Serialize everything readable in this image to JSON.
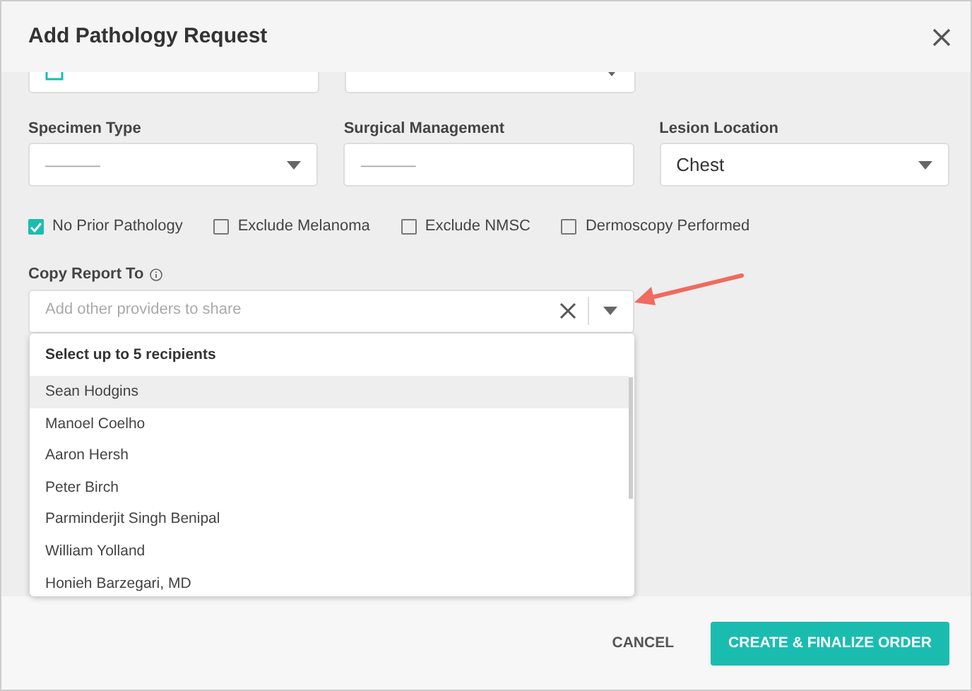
{
  "dialog": {
    "title": "Add Pathology Request"
  },
  "fields": [
    {
      "label": "Specimen Type",
      "placeholder": "———",
      "kind": "select"
    },
    {
      "label": "Surgical Management",
      "placeholder": "———",
      "kind": "text"
    },
    {
      "label": "Lesion Location",
      "value": "Chest",
      "kind": "select"
    }
  ],
  "checkboxes": [
    {
      "label": "No Prior Pathology",
      "checked": true
    },
    {
      "label": "Exclude Melanoma",
      "checked": false
    },
    {
      "label": "Exclude NMSC",
      "checked": false
    },
    {
      "label": "Dermoscopy Performed",
      "checked": false
    }
  ],
  "copy_report": {
    "label": "Copy Report To",
    "placeholder": "Add other providers to share",
    "expanded": true
  },
  "dropdown": {
    "heading": "Select up to 5 recipients",
    "options": [
      {
        "label": "Sean Hodgins",
        "selected": true
      },
      {
        "label": "Manoel Coelho",
        "selected": false
      },
      {
        "label": "Aaron Hersh",
        "selected": false
      },
      {
        "label": "Peter Birch",
        "selected": false
      },
      {
        "label": "Parminderjit Singh Benipal",
        "selected": false
      },
      {
        "label": "William Yolland",
        "selected": false
      },
      {
        "label": "Honieh Barzegari, MD",
        "selected": false
      }
    ]
  },
  "buttons": [
    {
      "label": "CANCEL",
      "kind": "text"
    },
    {
      "label": "CREATE & FINALIZE ORDER",
      "kind": "primary"
    }
  ]
}
